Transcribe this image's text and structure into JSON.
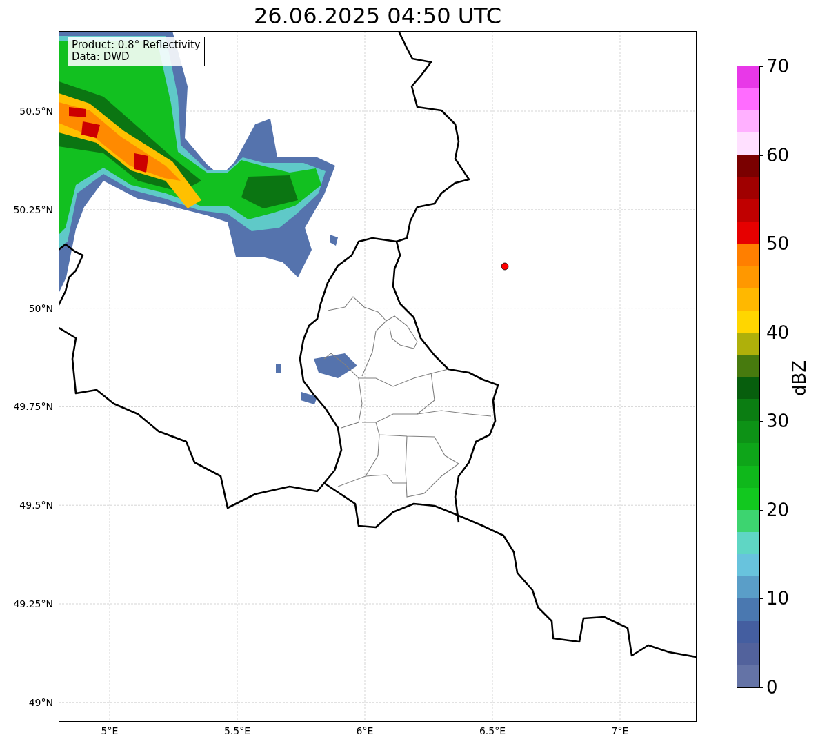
{
  "title": "26.06.2025 04:50 UTC",
  "map": {
    "annotation": [
      "Product: 0.8° Reflectivity",
      "Data: DWD"
    ],
    "lat_labels": [
      "50.5°N",
      "50.25°N",
      "50°N",
      "49.75°N",
      "49.5°N",
      "49.25°N",
      "49°N"
    ],
    "lon_labels": [
      "5°E",
      "5.5°E",
      "6°E",
      "6.5°E",
      "7°E"
    ]
  },
  "colorbar": {
    "label": "dBZ",
    "ticks": [
      "70",
      "60",
      "50",
      "40",
      "30",
      "20",
      "10",
      "0"
    ],
    "bins": [
      {
        "color": "#6473a6"
      },
      {
        "color": "#52629c"
      },
      {
        "color": "#445ea0"
      },
      {
        "color": "#4a78b0"
      },
      {
        "color": "#5a9ec8"
      },
      {
        "color": "#68c3dd"
      },
      {
        "color": "#5fd6c4"
      },
      {
        "color": "#3dd470"
      },
      {
        "color": "#12c81f"
      },
      {
        "color": "#0fb81b"
      },
      {
        "color": "#0ea519"
      },
      {
        "color": "#0d9216"
      },
      {
        "color": "#0b7d12"
      },
      {
        "color": "#075e0d"
      },
      {
        "color": "#477a0e"
      },
      {
        "color": "#afb00a"
      },
      {
        "color": "#ffd600"
      },
      {
        "color": "#ffb800"
      },
      {
        "color": "#ff9800"
      },
      {
        "color": "#ff7f00"
      },
      {
        "color": "#e60000"
      },
      {
        "color": "#c00000"
      },
      {
        "color": "#a00000"
      },
      {
        "color": "#7a0000"
      },
      {
        "color": "#ffe0ff"
      },
      {
        "color": "#ffb0ff"
      },
      {
        "color": "#ff6cff"
      },
      {
        "color": "#e838e8"
      }
    ]
  }
}
